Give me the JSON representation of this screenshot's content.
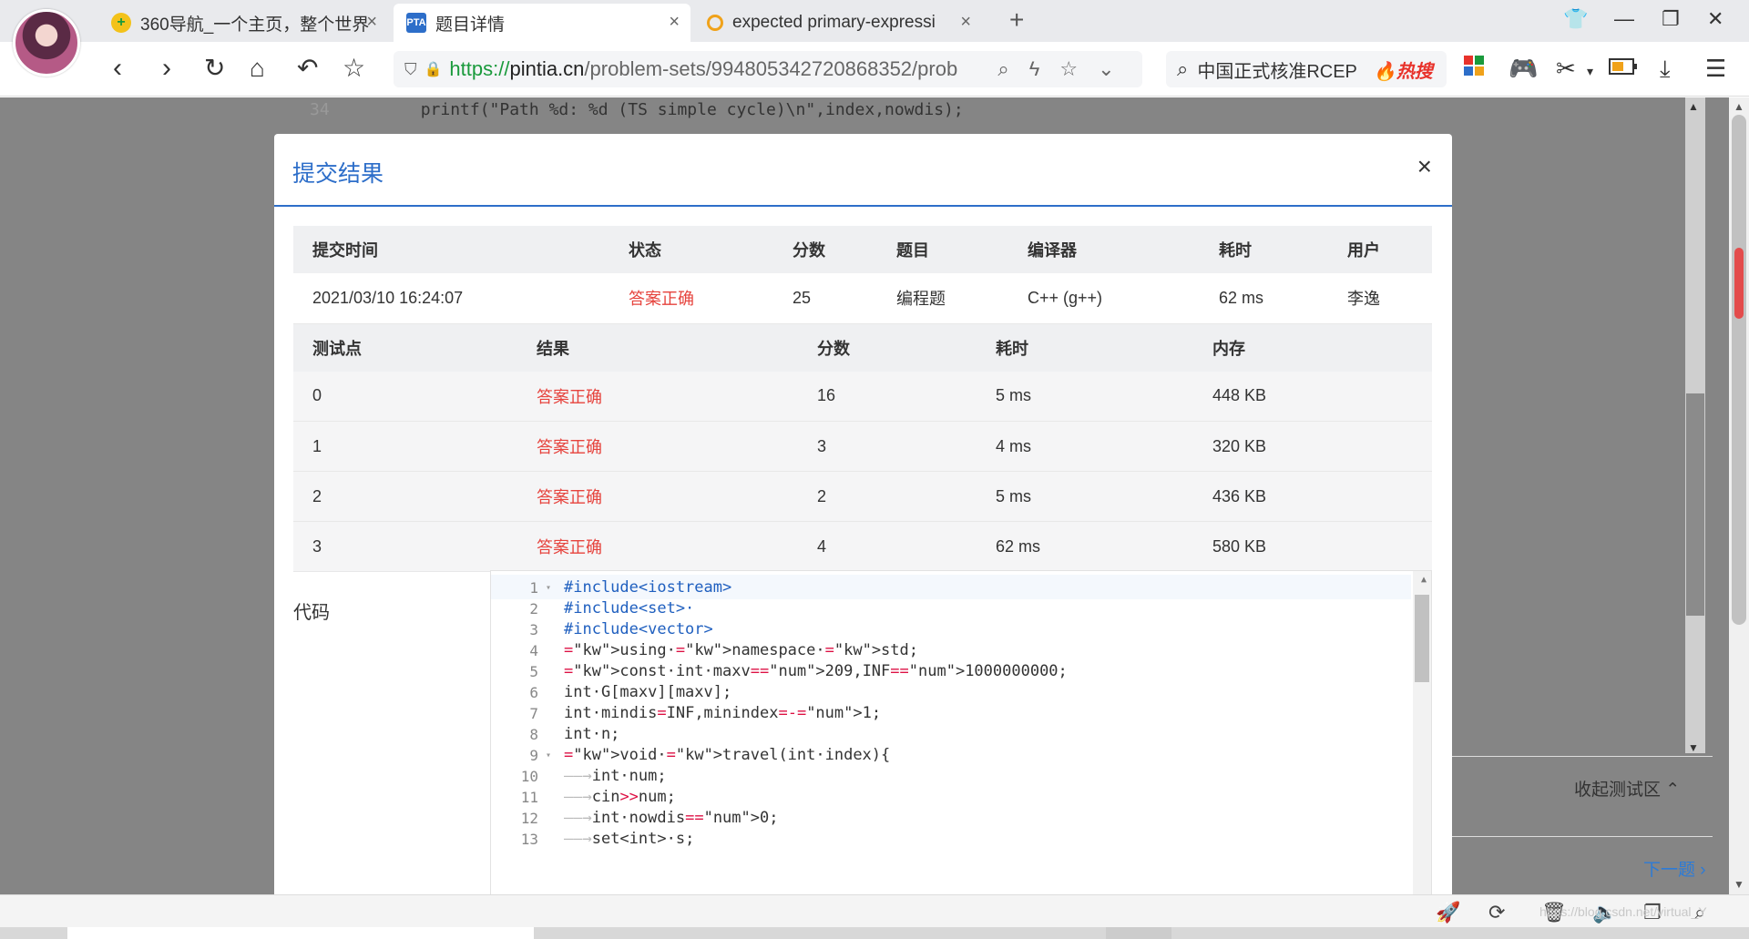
{
  "browser": {
    "tabs": [
      {
        "title": "360导航_一个主页，整个世界",
        "active": false
      },
      {
        "title": "题目详情",
        "active": true
      },
      {
        "title": "expected primary-expressi",
        "active": false
      }
    ],
    "url": {
      "scheme": "https://",
      "host": "pintia.cn",
      "path": "/problem-sets/994805342720868352/prob"
    },
    "search": {
      "text": "中国正式核准RCEP",
      "hot_label": "热搜"
    }
  },
  "background_page": {
    "line_number": "34",
    "code_line": "printf(\"Path %d: %d (TS simple cycle)\\n\",index,nowdis);",
    "collapse_label": "收起测试区 ⌃",
    "next_label": "下一题 ›"
  },
  "modal": {
    "title": "提交结果",
    "close": "×",
    "summary": {
      "headers": [
        "提交时间",
        "状态",
        "分数",
        "题目",
        "编译器",
        "耗时",
        "用户"
      ],
      "row": [
        "2021/03/10 16:24:07",
        "答案正确",
        "25",
        "编程题",
        "C++ (g++)",
        "62 ms",
        "李逸"
      ]
    },
    "tests": {
      "headers": [
        "测试点",
        "结果",
        "分数",
        "耗时",
        "内存"
      ],
      "rows": [
        [
          "0",
          "答案正确",
          "16",
          "5 ms",
          "448 KB"
        ],
        [
          "1",
          "答案正确",
          "3",
          "4 ms",
          "320 KB"
        ],
        [
          "2",
          "答案正确",
          "2",
          "5 ms",
          "436 KB"
        ],
        [
          "3",
          "答案正确",
          "4",
          "62 ms",
          "580 KB"
        ]
      ]
    },
    "code_label": "代码",
    "code_lines": [
      {
        "n": "1",
        "text": "#include<iostream>"
      },
      {
        "n": "2",
        "text": "#include<set>·"
      },
      {
        "n": "3",
        "text": "#include<vector>"
      },
      {
        "n": "4",
        "text": "using·namespace·std;"
      },
      {
        "n": "5",
        "text": "const·int·maxv=209,INF=1000000000;"
      },
      {
        "n": "6",
        "text": "int·G[maxv][maxv];"
      },
      {
        "n": "7",
        "text": "int·mindis=INF,minindex=-1;"
      },
      {
        "n": "8",
        "text": "int·n;"
      },
      {
        "n": "9",
        "text": "void·travel(int·index){"
      },
      {
        "n": "10",
        "text": "int·num;"
      },
      {
        "n": "11",
        "text": "cin>>num;"
      },
      {
        "n": "12",
        "text": "int·nowdis=0;"
      },
      {
        "n": "13",
        "text": "set<int>·s;"
      }
    ]
  },
  "statusbar": {
    "watermark": "https://blog.csdn.net/virtual_Y"
  },
  "colors": {
    "accent": "#2d6ec9",
    "status_ok": "#e6433d"
  }
}
